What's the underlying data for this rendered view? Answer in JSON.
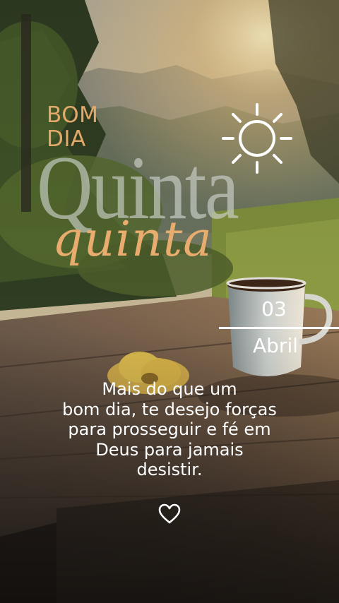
{
  "greeting": {
    "line1": "BOM",
    "line2": "DIA"
  },
  "weekday": {
    "display": "Quinta",
    "script": "quinta"
  },
  "date": {
    "day": "03",
    "month": "Abril"
  },
  "message": {
    "lines": [
      "Mais do que um",
      "bom dia, te desejo forças",
      "para prosseguir e fé em",
      "Deus para jamais",
      "desistir."
    ]
  },
  "icons": {
    "weather": "sun-icon",
    "decoration": "heart-icon"
  },
  "colors": {
    "accent": "#e3a96a",
    "text": "#ffffff",
    "faded_title": "#d2d6d2"
  }
}
